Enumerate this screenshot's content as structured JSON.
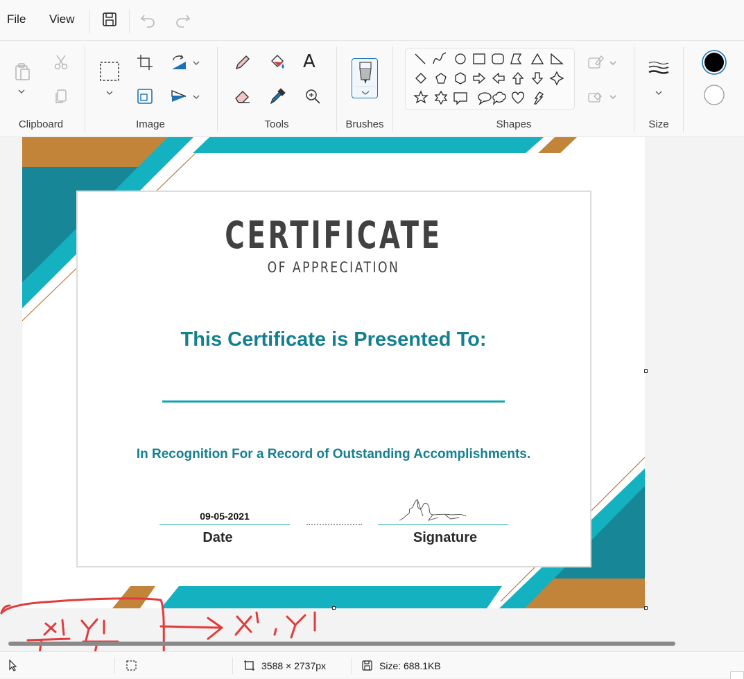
{
  "menu": {
    "file": "File",
    "view": "View"
  },
  "ribbon": {
    "groups": {
      "clipboard": "Clipboard",
      "image": "Image",
      "tools": "Tools",
      "brushes": "Brushes",
      "shapes": "Shapes",
      "size": "Size"
    },
    "tools_text_icon": "A"
  },
  "colors": {
    "primary": "#000000",
    "secondary": "#ffffff",
    "accent": "#14a3b3"
  },
  "certificate": {
    "title": "CERTIFICATE",
    "subtitle": "OF APPRECIATION",
    "presented": "This Certificate is Presented To:",
    "recognition": "In Recognition For a Record of Outstanding Accomplishments.",
    "date_value": "09-05-2021",
    "date_label": "Date",
    "signature_label": "Signature"
  },
  "annotation": {
    "text": "→ x' ,y'"
  },
  "status": {
    "dimensions": "3588 × 2737px",
    "size": "Size: 688.1KB"
  }
}
